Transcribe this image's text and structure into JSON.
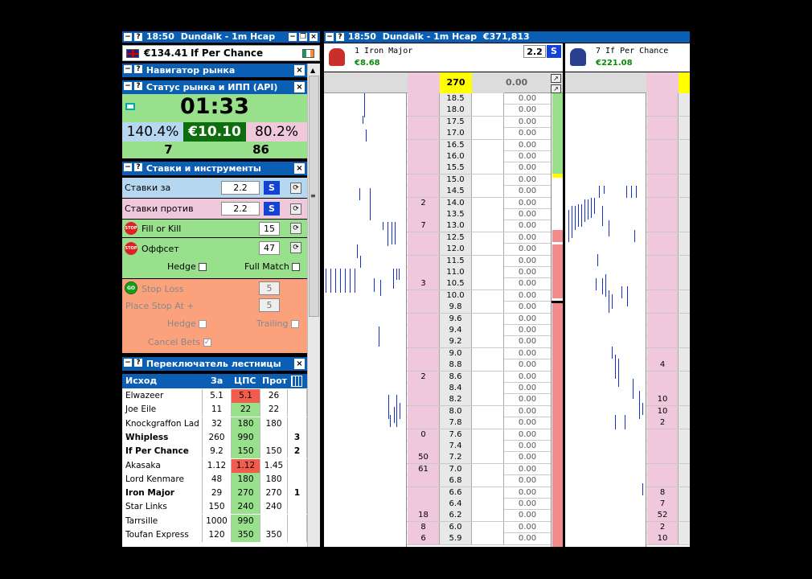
{
  "left_title": {
    "time": "18:50",
    "race": "Dundalk - 1m Hcap"
  },
  "right_title": {
    "time": "18:50",
    "race": "Dundalk - 1m Hcap",
    "total": "€371,813"
  },
  "account": {
    "balance": "€134.41",
    "runner": "If Per Chance"
  },
  "navigator": {
    "title": "Навигатор рынка"
  },
  "status": {
    "title": "Статус рынка и ИПП (API)",
    "countdown": "01:33",
    "back_pct": "140.4%",
    "matched": "€10.10",
    "lay_pct": "80.2%",
    "back_count": "7",
    "lay_count": "86"
  },
  "tools": {
    "title": "Ставки и инструменты",
    "back_label": "Ставки за",
    "back_value": "2.2",
    "back_btn": "S",
    "lay_label": "Ставки против",
    "lay_value": "2.2",
    "lay_btn": "S",
    "fok_label": "Fill or Kill",
    "fok_value": "15",
    "offset_label": "Оффсет",
    "offset_value": "47",
    "hedge_label": "Hedge",
    "fullmatch_label": "Full Match",
    "stoploss_label": "Stop Loss",
    "stoploss_value": "5",
    "placestop_label": "Place Stop At +",
    "placestop_value": "5",
    "hedge2_label": "Hedge",
    "trailing_label": "Trailing",
    "cancel_label": "Cancel Bets"
  },
  "switcher": {
    "title": "Переключатель лестницы",
    "headers": [
      "Исход",
      "За",
      "ЦПС",
      "Прот"
    ],
    "rows": [
      [
        "Elwazeer",
        "5.1",
        "5.1",
        "26",
        ""
      ],
      [
        "Joe Eile",
        "11",
        "22",
        "22",
        ""
      ],
      [
        "Knockgraffon Lad",
        "32",
        "180",
        "180",
        ""
      ],
      [
        "Whipless",
        "260",
        "990",
        "",
        "3"
      ],
      [
        "If Per Chance",
        "9.2",
        "150",
        "150",
        "2"
      ],
      [
        "Akasaka",
        "1.12",
        "1.12",
        "1.45",
        ""
      ],
      [
        "Lord Kenmare",
        "48",
        "180",
        "180",
        ""
      ],
      [
        "Iron Major",
        "29",
        "270",
        "270",
        "1"
      ],
      [
        "Star Links",
        "150",
        "240",
        "240",
        ""
      ],
      [
        "Tarrsille",
        "1000",
        "990",
        "",
        ""
      ],
      [
        "Toufan Express",
        "120",
        "350",
        "350",
        ""
      ]
    ]
  },
  "runner1": {
    "name": "1 Iron Major",
    "pl": "€8.68",
    "odds": "2.2",
    "btn": "S",
    "ltp": "270",
    "zero": "0.00"
  },
  "runner2": {
    "name": "7 If Per Chance",
    "pl": "€221.08"
  },
  "ladder": {
    "prices": [
      "18.5",
      "18.0",
      "17.5",
      "17.0",
      "16.5",
      "16.0",
      "15.5",
      "15.0",
      "14.5",
      "14.0",
      "13.5",
      "13.0",
      "12.5",
      "12.0",
      "11.5",
      "11.0",
      "10.5",
      "10.0",
      "9.8",
      "9.6",
      "9.4",
      "9.2",
      "9.0",
      "8.8",
      "8.6",
      "8.4",
      "8.2",
      "8.0",
      "7.8",
      "7.6",
      "7.4",
      "7.2",
      "7.0",
      "6.8",
      "6.6",
      "6.4",
      "6.2",
      "6.0",
      "5.9"
    ],
    "back": [
      "",
      "",
      "",
      "",
      "",
      "",
      "",
      "",
      "",
      "2",
      "",
      "7",
      "",
      "",
      "",
      "",
      "3",
      "",
      "",
      "",
      "",
      "",
      "",
      "",
      "2",
      "",
      "",
      "",
      "",
      "0",
      "",
      "50",
      "61",
      "",
      "",
      "",
      "18",
      "8",
      "6"
    ],
    "lay": "0.00",
    "back2": [
      "",
      "",
      "",
      "",
      "",
      "",
      "",
      "",
      "",
      "",
      "",
      "",
      "",
      "",
      "",
      "",
      "",
      "",
      "",
      "",
      "",
      "",
      "",
      "4",
      "",
      "",
      "10",
      "10",
      "2",
      "",
      "",
      "",
      "",
      "",
      "8",
      "7",
      "52",
      "2",
      "10"
    ]
  },
  "colors": {
    "title_bg": "#0a5fb4",
    "green": "#98e08c",
    "pink": "#f0c8dc",
    "salmon": "#fba27c",
    "ltp_yellow": "#ffff00",
    "s_button": "#1242d6"
  }
}
